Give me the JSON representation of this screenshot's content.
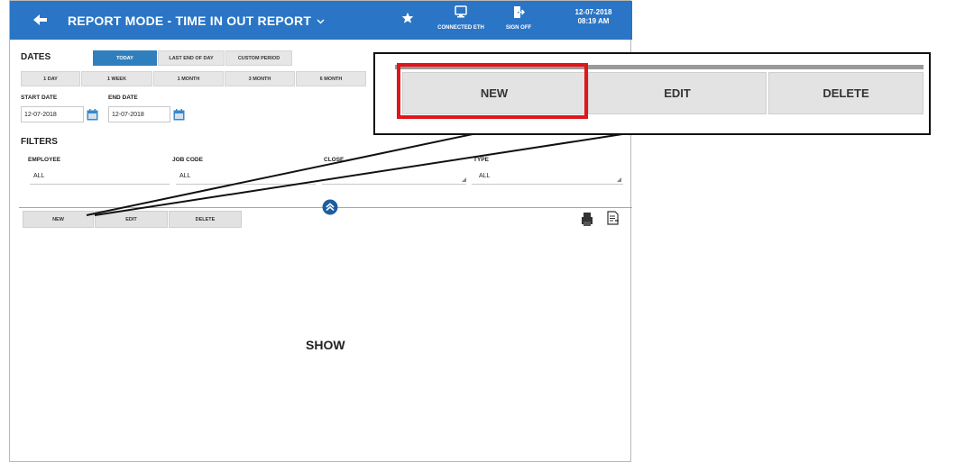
{
  "header": {
    "title": "REPORT MODE - TIME IN OUT REPORT",
    "connection_label": "CONNECTED ETH",
    "sign_off_label": "SIGN OFF",
    "date": "12-07-2018",
    "time": "08:19 AM"
  },
  "dates": {
    "label": "DATES",
    "tabs": [
      "TODAY",
      "LAST END OF DAY",
      "CUSTOM PERIOD"
    ],
    "active_tab": "TODAY",
    "ranges": [
      "1 DAY",
      "1 WEEK",
      "1 MONTH",
      "3 MONTH",
      "6 MONTH"
    ],
    "start_label": "START DATE",
    "end_label": "END DATE",
    "start_value": "12-07-2018",
    "end_value": "12-07-2018"
  },
  "filters": {
    "label": "FILTERS",
    "employee": {
      "label": "EMPLOYEE",
      "value": "ALL"
    },
    "job_code": {
      "label": "JOB CODE",
      "value": "ALL"
    },
    "closed": {
      "label": "CLOSE"
    },
    "type": {
      "label": "TYPE",
      "value": "ALL"
    }
  },
  "actions": {
    "new": "NEW",
    "edit": "EDIT",
    "delete": "DELETE"
  },
  "content": {
    "show": "SHOW"
  },
  "zoom": {
    "new": "NEW",
    "edit": "EDIT",
    "delete": "DELETE"
  },
  "colors": {
    "header": "#2a75c6",
    "active_tab": "#2f7fbf",
    "highlight": "#e0161a"
  }
}
